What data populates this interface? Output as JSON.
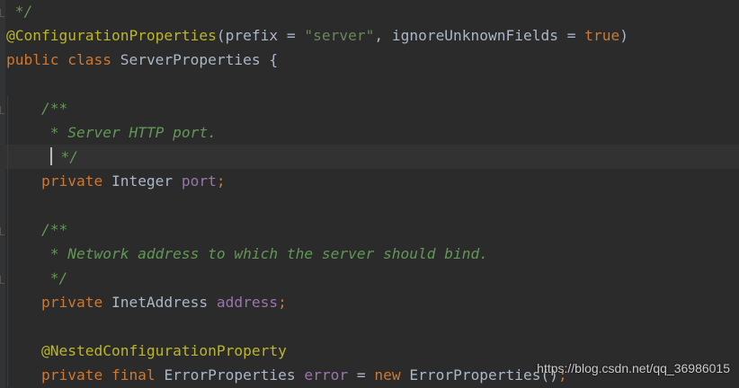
{
  "colors": {
    "background": "#2b2b2b",
    "comment": "#629755",
    "annotation": "#bbb529",
    "keyword": "#cc7832",
    "string": "#6a8759",
    "field": "#9876aa",
    "plain": "#a9b7c6"
  },
  "code": {
    "lines": [
      {
        "tokens": [
          {
            "t": "comment",
            "v": " */"
          }
        ]
      },
      {
        "tokens": [
          {
            "t": "anno",
            "v": "@ConfigurationProperties"
          },
          {
            "t": "plain",
            "v": "(prefix = "
          },
          {
            "t": "str",
            "v": "\"server\""
          },
          {
            "t": "plain",
            "v": ", ignoreUnknownFields = "
          },
          {
            "t": "kw",
            "v": "true"
          },
          {
            "t": "plain",
            "v": ")"
          }
        ]
      },
      {
        "tokens": [
          {
            "t": "kw",
            "v": "public class "
          },
          {
            "t": "plain",
            "v": "ServerProperties {"
          }
        ]
      },
      {
        "tokens": []
      },
      {
        "tokens": [
          {
            "t": "comment",
            "v": "    /**"
          }
        ]
      },
      {
        "tokens": [
          {
            "t": "comment",
            "v": "     * Server HTTP port."
          }
        ]
      },
      {
        "current": true,
        "tokens": [
          {
            "t": "caret",
            "v": ""
          },
          {
            "t": "comment",
            "v": " */"
          }
        ]
      },
      {
        "tokens": [
          {
            "t": "kw",
            "v": "    private "
          },
          {
            "t": "plain",
            "v": "Integer "
          },
          {
            "t": "field",
            "v": "port"
          },
          {
            "t": "kw",
            "v": ";"
          }
        ]
      },
      {
        "tokens": []
      },
      {
        "tokens": [
          {
            "t": "comment",
            "v": "    /**"
          }
        ]
      },
      {
        "tokens": [
          {
            "t": "comment",
            "v": "     * Network address to which the server should bind."
          }
        ]
      },
      {
        "tokens": [
          {
            "t": "comment",
            "v": "     */"
          }
        ]
      },
      {
        "tokens": [
          {
            "t": "kw",
            "v": "    private "
          },
          {
            "t": "plain",
            "v": "InetAddress "
          },
          {
            "t": "field",
            "v": "address"
          },
          {
            "t": "kw",
            "v": ";"
          }
        ]
      },
      {
        "tokens": []
      },
      {
        "tokens": [
          {
            "t": "anno",
            "v": "    @NestedConfigurationProperty"
          }
        ]
      },
      {
        "tokens": [
          {
            "t": "kw",
            "v": "    private final "
          },
          {
            "t": "plain",
            "v": "ErrorProperties "
          },
          {
            "t": "field",
            "v": "error"
          },
          {
            "t": "plain",
            "v": " = "
          },
          {
            "t": "kw",
            "v": "new "
          },
          {
            "t": "plain",
            "v": "ErrorProperties()"
          },
          {
            "t": "kw",
            "v": ";"
          }
        ]
      }
    ]
  },
  "watermark": "https://blog.csdn.net/qq_36986015"
}
